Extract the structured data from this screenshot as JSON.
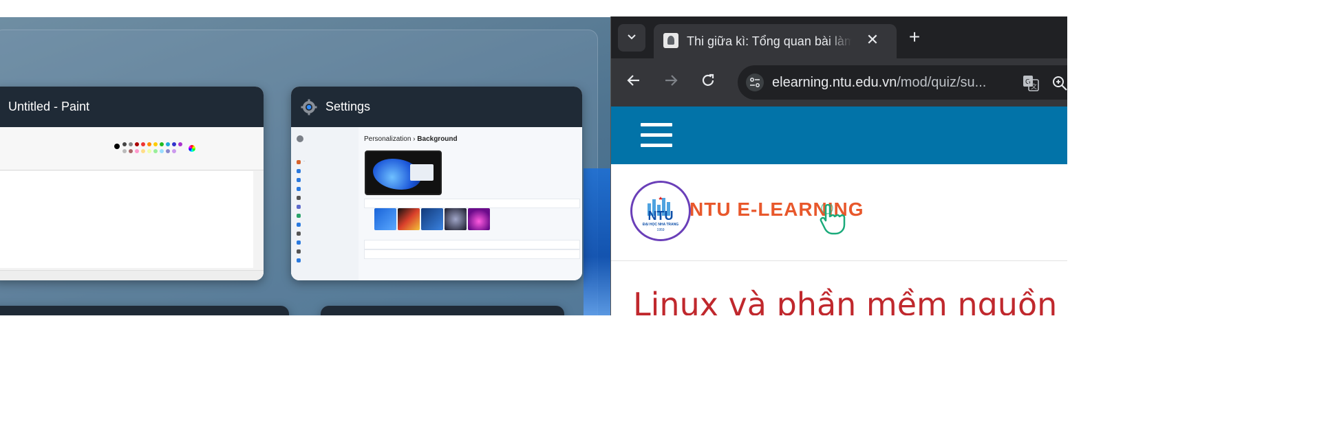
{
  "task_view": {
    "windows": [
      {
        "title": "Untitled - Paint",
        "icon": "paint-icon"
      },
      {
        "title": "Settings",
        "icon": "gear-icon"
      }
    ],
    "settings_preview": {
      "breadcrumb_parent": "Personalization",
      "breadcrumb_sep": "›",
      "breadcrumb_current": "Background"
    }
  },
  "browser": {
    "tab": {
      "title": "Thi giữa kì: Tổng quan bài làm thử",
      "favicon": "quiz-favicon"
    },
    "new_tab_symbol": "+",
    "close_symbol": "✕",
    "address": {
      "host": "elearning.ntu.edu.vn",
      "path": "/mod/quiz/su..."
    },
    "site": {
      "menu_icon": "hamburger-icon",
      "logo_badge_text": "NTU",
      "logo_badge_sub": "ĐẠI HỌC NHA TRANG",
      "logo_badge_year": "1959",
      "brand_text": "NTU E-LEARNING",
      "course_title": "Linux và phần mềm nguồn mở"
    }
  },
  "colors": {
    "site_header": "#0273a8",
    "brand_orange": "#e8582c",
    "course_title_red": "#c0282d",
    "chrome_dark": "#202124",
    "chrome_toolbar": "#35363a"
  }
}
